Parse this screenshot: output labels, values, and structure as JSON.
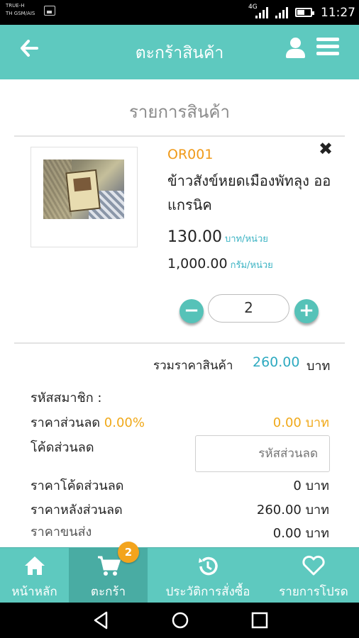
{
  "status_bar": {
    "carrier_line1": "TRUE-H",
    "carrier_line2": "TH GSM/AIS",
    "network_type": "4G",
    "time": "11:27"
  },
  "app_bar": {
    "title": "ตะกร้าสินค้า",
    "icons": [
      "back-arrow-icon",
      "user-icon",
      "menu-icon"
    ]
  },
  "section_title": "รายการสินค้า",
  "cart_item": {
    "code": "OR001",
    "name": "ข้าวสังข์หยดเมืองพัทลุง ออแกรนิค",
    "price": "130.00",
    "price_unit": "บาท/หน่วย",
    "weight": "1,000.00",
    "weight_unit": "กรัม/หน่วย",
    "quantity": "2"
  },
  "summary": {
    "total_label": "รวมราคาสินค้า",
    "total_value": "260.00",
    "currency": "บาท",
    "member_code_label": "รหัสสมาชิก :",
    "discount_label": "ราคาส่วนลด",
    "discount_percent": "0.00%",
    "discount_value": "0.00 บาท",
    "discount_code_label": "โค้ดส่วนลด",
    "discount_code_placeholder": "รหัสส่วนลด",
    "code_discount_label": "ราคาโค้ดส่วนลด",
    "code_discount_value": "0 บาท",
    "after_discount_label": "ราคาหลังส่วนลด",
    "after_discount_value": "260.00 บาท",
    "shipping_label": "ราคาขนส่ง",
    "shipping_value": "0.00 บาท"
  },
  "tab_bar": {
    "tabs": [
      {
        "label": "หน้าหลัก",
        "icon": "home-icon"
      },
      {
        "label": "ตะกร้า",
        "icon": "cart-icon",
        "active": true,
        "badge": "2"
      },
      {
        "label": "ประวัติการสั่งซื้อ",
        "icon": "history-icon"
      },
      {
        "label": "รายการโปรด",
        "icon": "heart-icon"
      }
    ]
  },
  "colors": {
    "primary": "#5ec9bf",
    "accent_orange": "#f0a91a",
    "price_teal": "#2eaac0"
  }
}
